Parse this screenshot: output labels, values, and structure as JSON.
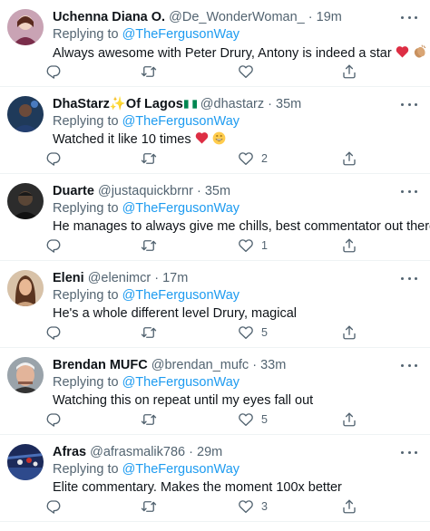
{
  "reply_prefix": "Replying to",
  "tweets": [
    {
      "name": "Uchenna Diana O.",
      "handle": "@De_WonderWoman_",
      "separator": "·",
      "time": "19m",
      "reply_to": "@TheFergusonWay",
      "text": "Always awesome with Peter Drury, Antony is indeed a star",
      "like_count": ""
    },
    {
      "name": "DhaStarz",
      "name_suffix": "Of Lagos",
      "handle": "@dhastarz",
      "separator": "·",
      "time": "35m",
      "reply_to": "@TheFergusonWay",
      "text": "Watched it like 10 times",
      "like_count": "2"
    },
    {
      "name": "Duarte",
      "handle": "@justaquickbrnr",
      "separator": "·",
      "time": "35m",
      "reply_to": "@TheFergusonWay",
      "text": "He manages to always give me chills, best commentator out there",
      "like_count": "1"
    },
    {
      "name": "Eleni",
      "handle": "@elenimcr",
      "separator": "·",
      "time": "17m",
      "reply_to": "@TheFergusonWay",
      "text": "He's a whole different level Drury, magical",
      "like_count": "5"
    },
    {
      "name": "Brendan MUFC",
      "handle": "@brendan_mufc",
      "separator": "·",
      "time": "33m",
      "reply_to": "@TheFergusonWay",
      "text": "Watching this on repeat until my eyes fall out",
      "like_count": "5"
    },
    {
      "name": "Afras",
      "handle": "@afrasmalik786",
      "separator": "·",
      "time": "29m",
      "reply_to": "@TheFergusonWay",
      "text": "Elite commentary. Makes the moment 100x better",
      "like_count": "3"
    }
  ],
  "colors": {
    "link": "#1d9bf0",
    "secondary_text": "#536471",
    "primary_text": "#0f1419",
    "heart": "#e0245e"
  }
}
